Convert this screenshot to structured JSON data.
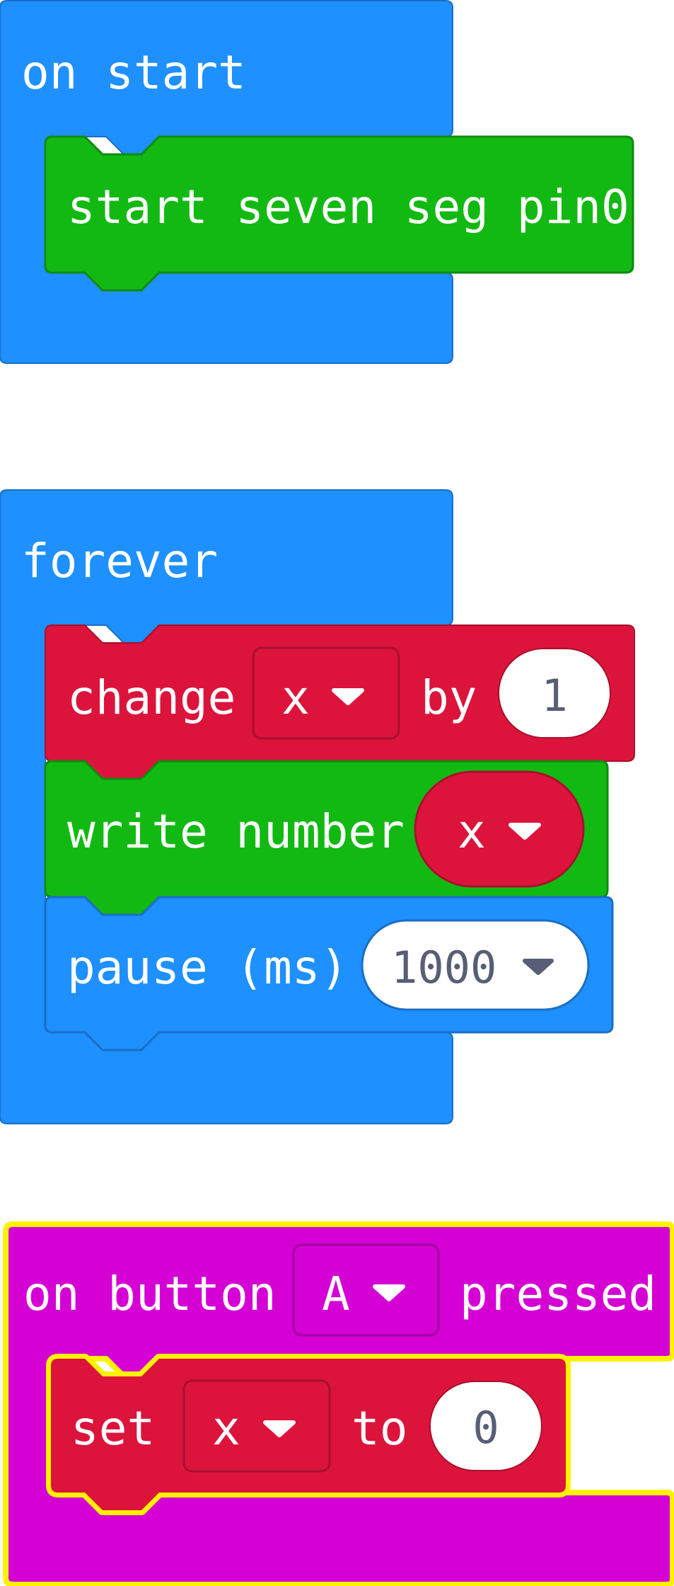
{
  "colors": {
    "events": "#1E90FF",
    "events_dark": "#1A6EC5",
    "extension": "#13B913",
    "extension_dark": "#0E8C0E",
    "variables": "#DC143C",
    "variables_dark": "#A8102E",
    "input": "#D400D4",
    "input_dark": "#9E009E",
    "selected_outline": "#FFF200",
    "number_text": "#575E75",
    "white": "#FFFFFF"
  },
  "workspace": {
    "on_start": {
      "label": "on start",
      "child": {
        "label": "start seven seg pin0"
      }
    },
    "forever": {
      "label": "forever",
      "statements": {
        "change": {
          "prefix": "change",
          "variable": "x",
          "connector": "by",
          "value": "1"
        },
        "write": {
          "prefix": "write number",
          "variable": "x"
        },
        "pause": {
          "prefix": "pause (ms)",
          "value": "1000"
        }
      }
    },
    "on_button": {
      "prefix": "on button",
      "button": "A",
      "suffix": "pressed",
      "selected": true,
      "child": {
        "prefix": "set",
        "variable": "x",
        "connector": "to",
        "value": "0"
      }
    }
  }
}
